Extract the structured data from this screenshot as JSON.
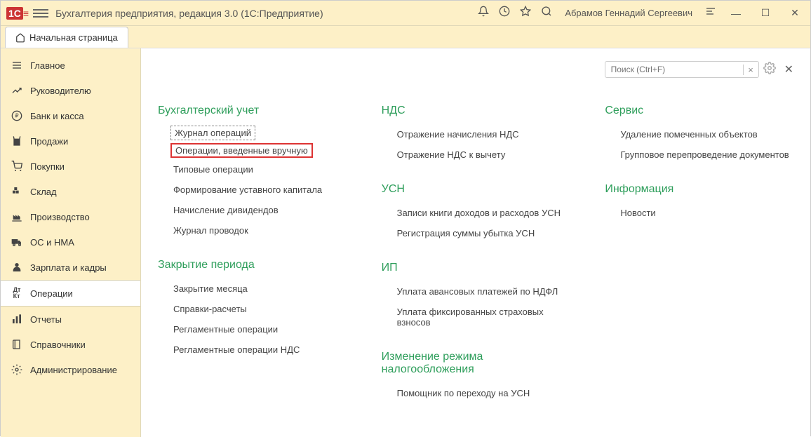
{
  "titlebar": {
    "logo": "1C",
    "title": "Бухгалтерия предприятия, редакция 3.0  (1С:Предприятие)",
    "user": "Абрамов Геннадий Сергеевич"
  },
  "tab": {
    "label": "Начальная страница"
  },
  "sidebar": [
    {
      "icon": "menu",
      "label": "Главное",
      "active": false
    },
    {
      "icon": "chart",
      "label": "Руководителю",
      "active": false
    },
    {
      "icon": "ruble",
      "label": "Банк и касса",
      "active": false
    },
    {
      "icon": "bag",
      "label": "Продажи",
      "active": false
    },
    {
      "icon": "cart",
      "label": "Покупки",
      "active": false
    },
    {
      "icon": "warehouse",
      "label": "Склад",
      "active": false
    },
    {
      "icon": "factory",
      "label": "Производство",
      "active": false
    },
    {
      "icon": "truck",
      "label": "ОС и НМА",
      "active": false
    },
    {
      "icon": "person",
      "label": "Зарплата и кадры",
      "active": false
    },
    {
      "icon": "dtkt",
      "label": "Операции",
      "active": true
    },
    {
      "icon": "bars",
      "label": "Отчеты",
      "active": false
    },
    {
      "icon": "books",
      "label": "Справочники",
      "active": false
    },
    {
      "icon": "gear",
      "label": "Администрирование",
      "active": false
    }
  ],
  "search": {
    "placeholder": "Поиск (Ctrl+F)",
    "clear": "×"
  },
  "columns": [
    {
      "sections": [
        {
          "title": "Бухгалтерский учет",
          "items": [
            {
              "label": "Журнал операций",
              "dashed": true
            },
            {
              "label": "Операции, введенные вручную",
              "redbox": true
            },
            {
              "label": "Типовые операции"
            },
            {
              "label": "Формирование уставного капитала"
            },
            {
              "label": "Начисление дивидендов"
            },
            {
              "label": "Журнал проводок"
            }
          ]
        },
        {
          "title": "Закрытие периода",
          "items": [
            {
              "label": "Закрытие месяца"
            },
            {
              "label": "Справки-расчеты"
            },
            {
              "label": "Регламентные операции"
            },
            {
              "label": "Регламентные операции НДС"
            }
          ]
        }
      ]
    },
    {
      "sections": [
        {
          "title": "НДС",
          "items": [
            {
              "label": "Отражение начисления НДС"
            },
            {
              "label": "Отражение НДС к вычету"
            }
          ]
        },
        {
          "title": "УСН",
          "items": [
            {
              "label": "Записи книги доходов и расходов УСН"
            },
            {
              "label": "Регистрация суммы убытка УСН"
            }
          ]
        },
        {
          "title": "ИП",
          "items": [
            {
              "label": "Уплата авансовых платежей по НДФЛ"
            },
            {
              "label": "Уплата фиксированных страховых взносов"
            }
          ]
        },
        {
          "title": "Изменение режима налогообложения",
          "items": [
            {
              "label": "Помощник по переходу на УСН"
            }
          ]
        }
      ]
    },
    {
      "sections": [
        {
          "title": "Сервис",
          "items": [
            {
              "label": "Удаление помеченных объектов"
            },
            {
              "label": "Групповое перепроведение документов"
            }
          ]
        },
        {
          "title": "Информация",
          "items": [
            {
              "label": "Новости"
            }
          ]
        }
      ]
    }
  ]
}
